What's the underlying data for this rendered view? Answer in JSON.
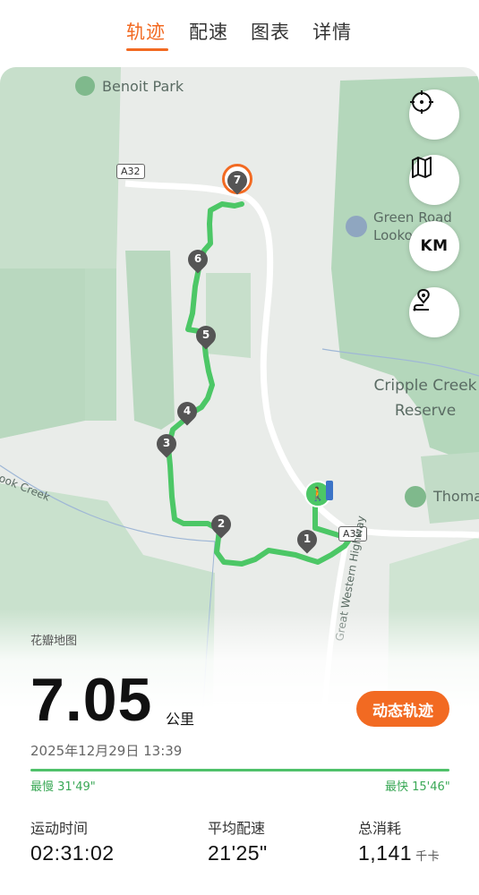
{
  "tabs": [
    {
      "label": "轨迹",
      "active": true
    },
    {
      "label": "配速",
      "active": false
    },
    {
      "label": "图表",
      "active": false
    },
    {
      "label": "详情",
      "active": false
    }
  ],
  "map": {
    "places": {
      "park": "Benoit Park",
      "lookout": "Green Road Lookout",
      "reserve": "Cripple Creek Reserve",
      "thomas": "Thoma",
      "creek": "ook Creek",
      "highway": "Great Western Highway",
      "road_badge": "A32",
      "road_badge_2": "A32"
    },
    "markers": [
      "1",
      "2",
      "3",
      "4",
      "5",
      "6",
      "7"
    ],
    "controls": {
      "locate_icon": "crosshair-icon",
      "map_icon": "map-icon",
      "km_label": "KM",
      "route_icon": "route-icon"
    },
    "colors": {
      "route": "#4cc766",
      "accent": "#f26a22"
    }
  },
  "summary": {
    "map_source": "花瓣地图",
    "distance": "7.05",
    "distance_unit": "公里",
    "date": "2025年12月29日 13:39",
    "dynamic_track_label": "动态轨迹",
    "slowest": "最慢 31'49\"",
    "fastest": "最快 15'46\""
  },
  "stats": {
    "duration_label": "运动时间",
    "duration_value": "02:31:02",
    "pace_label": "平均配速",
    "pace_value": "21'25\"",
    "calories_label": "总消耗",
    "calories_value": "1,141",
    "calories_unit": "千卡"
  }
}
